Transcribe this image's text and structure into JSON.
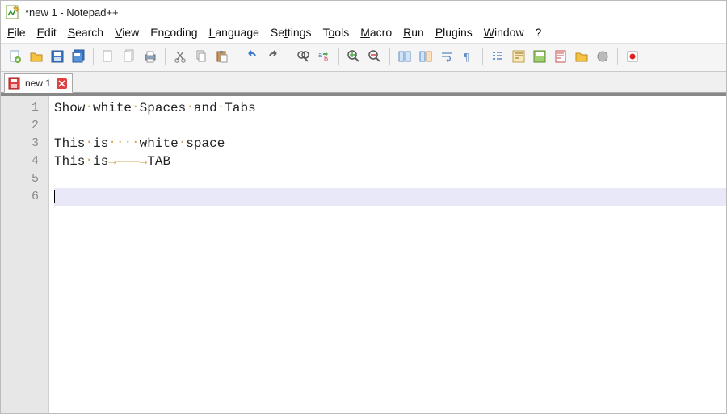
{
  "window": {
    "title": "*new 1 - Notepad++"
  },
  "menu": {
    "file": "File",
    "edit": "Edit",
    "search": "Search",
    "view": "View",
    "encoding": "Encoding",
    "language": "Language",
    "settings": "Settings",
    "tools": "Tools",
    "macro": "Macro",
    "run": "Run",
    "plugins": "Plugins",
    "window": "Window",
    "help": "?"
  },
  "tab": {
    "label": "new 1"
  },
  "lines": {
    "l1_w0": "Show",
    "l1_w1": "white",
    "l1_w2": "Spaces",
    "l1_w3": "and",
    "l1_w4": "Tabs",
    "l3_w0": "This",
    "l3_w1": "is",
    "l3_w2": "white",
    "l3_w3": "space",
    "l4_w0": "This",
    "l4_w1": "is",
    "l4_w2": "TAB"
  },
  "gutter": {
    "n1": "1",
    "n2": "2",
    "n3": "3",
    "n4": "4",
    "n5": "5",
    "n6": "6"
  },
  "glyph": {
    "dot": "·",
    "arrow": "→",
    "arrow_long": "———→"
  }
}
